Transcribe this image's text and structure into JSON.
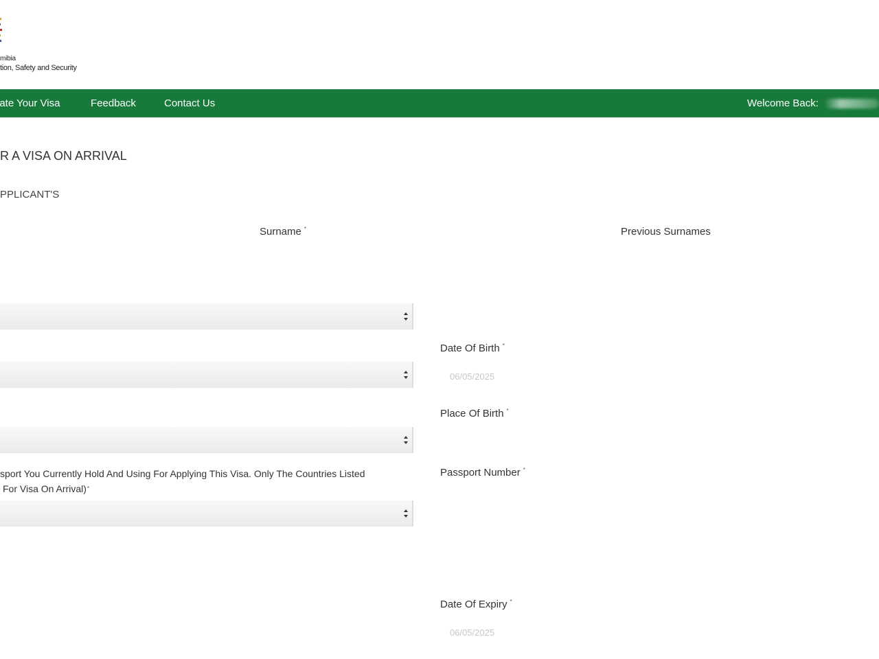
{
  "header": {
    "logo_line1": "mibia",
    "logo_line2": "tion, Safety and Security"
  },
  "nav": {
    "items": [
      "late Your Visa",
      "Feedback",
      "Contact Us"
    ],
    "welcome": "Welcome Back:",
    "color": "#177a3a"
  },
  "page": {
    "title": "R A VISA ON ARRIVAL",
    "section": "PPLICANT'S"
  },
  "form": {
    "surname_label": "Surname",
    "previous_surnames_label": "Previous Surnames",
    "dob_label": "Date Of Birth",
    "dob_value": "06/05/2025",
    "place_of_birth_label": "Place Of Birth",
    "passport_country_label_line1": "sport You Currently Hold And Using For Applying This Visa. Only The Countries Listed",
    "passport_country_label_line2": "For Visa On Arrival)",
    "passport_number_label": "Passport Number",
    "expiry_label": "Date Of Expiry",
    "expiry_value": "06/05/2025",
    "required_mark": "*"
  }
}
